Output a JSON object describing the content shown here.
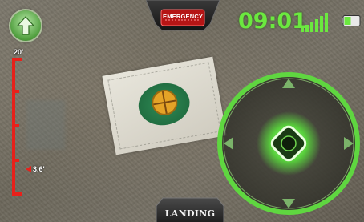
{
  "hud": {
    "emergency_label": "EMERGENCY",
    "clock": "09:01",
    "landing_label": "LANDING"
  },
  "altitude": {
    "max_label": "20'",
    "current_label": "3.6'",
    "current_value_ft": 3.6,
    "max_value_ft": 20
  },
  "status": {
    "signal_bars": 4,
    "battery_fraction": 0.45
  },
  "colors": {
    "accent_green": "#6be83f",
    "emergency_red": "#e02020",
    "altitude_red": "#e8201a"
  },
  "icons": {
    "takeoff": "up-arrow-icon",
    "signal": "signal-bars-icon",
    "battery": "battery-icon",
    "joystick": "directional-joystick"
  }
}
